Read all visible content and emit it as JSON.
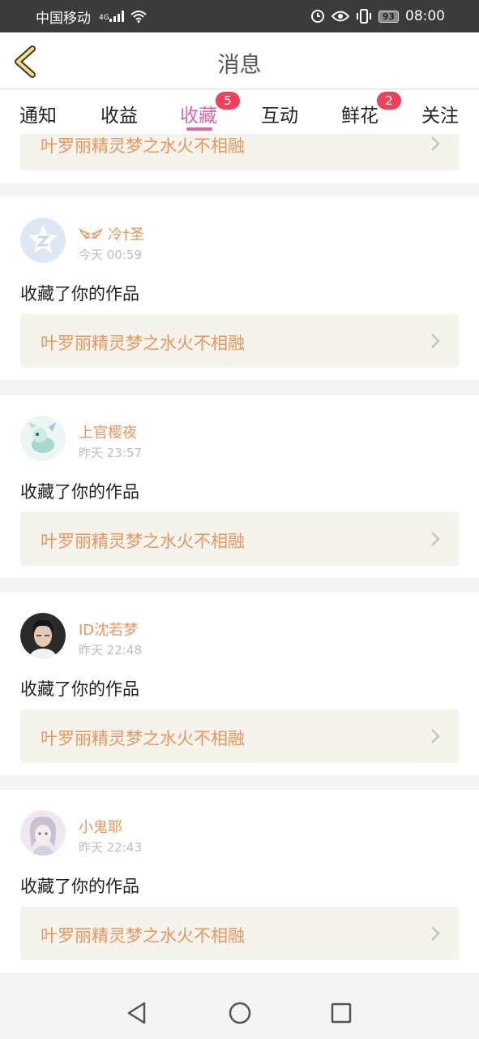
{
  "status_bar": {
    "carrier": "中国移动",
    "network": "4G",
    "battery": "93",
    "time": "08:00"
  },
  "header": {
    "title": "消息",
    "back_icon": "chevron-left-icon"
  },
  "tabs": [
    {
      "label": "通知",
      "badge": null,
      "active": false
    },
    {
      "label": "收益",
      "badge": null,
      "active": false
    },
    {
      "label": "收藏",
      "badge": "5",
      "active": true
    },
    {
      "label": "互动",
      "badge": null,
      "active": false
    },
    {
      "label": "鲜花",
      "badge": "2",
      "active": false
    },
    {
      "label": "关注",
      "badge": null,
      "active": false
    }
  ],
  "partial_item": {
    "work_title": "叶罗丽精灵梦之水火不相融"
  },
  "items": [
    {
      "username": "冷†圣",
      "has_wings_icon": true,
      "time": "今天 00:59",
      "action": "收藏了你的作品",
      "work_title": "叶罗丽精灵梦之水火不相融"
    },
    {
      "username": "上官樱夜",
      "time": "昨天 23:57",
      "action": "收藏了你的作品",
      "work_title": "叶罗丽精灵梦之水火不相融"
    },
    {
      "username": "ID沈若梦",
      "time": "昨天 22:48",
      "action": "收藏了你的作品",
      "work_title": "叶罗丽精灵梦之水火不相融"
    },
    {
      "username": "小鬼耶",
      "time": "昨天 22:43",
      "action": "收藏了你的作品",
      "work_title": "叶罗丽精灵梦之水火不相融"
    }
  ],
  "colors": {
    "accent": "#e364a3",
    "badge": "#f0405a",
    "username": "#e9965e",
    "work_box": "#f4f3ec"
  }
}
